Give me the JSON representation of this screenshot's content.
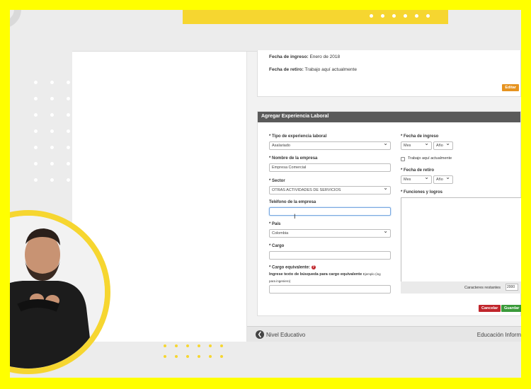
{
  "info": {
    "fecha_ingreso_label": "Fecha de ingreso:",
    "fecha_ingreso_value": "Enero de 2018",
    "fecha_retiro_label": "Fecha de retiro:",
    "fecha_retiro_value": "Trabajo aquí actualmente",
    "editar_label": "Editar"
  },
  "form": {
    "title": "Agregar Experiencia Laboral",
    "tipo_label": "* Tipo de experiencia laboral",
    "tipo_value": "Asalariado",
    "empresa_label": "* Nombre de la empresa",
    "empresa_value": "Empresa Comercial",
    "sector_label": "* Sector",
    "sector_value": "OTRAS ACTIVIDADES DE SERVICIOS",
    "telefono_label": "Teléfono de la empresa",
    "telefono_value": "",
    "pais_label": "* País",
    "pais_value": "Colombia",
    "cargo_label": "* Cargo",
    "cargo_value": "",
    "cargo_eq_label": "* Cargo equivalente:",
    "cargo_eq_help": "?",
    "cargo_eq_hint": "Ingrese texto de búsqueda para cargo equivalente",
    "cargo_eq_example": "Ejemplo (ing",
    "cargo_eq_example2": "para ingeniero)",
    "cargo_eq_value": "",
    "fecha_ingreso_label": "* Fecha de ingreso",
    "mes_value": "Mes",
    "anio_value": "Año",
    "actual_label": "Trabajo aquí actualmente",
    "fecha_retiro_label": "* Fecha de retiro",
    "mes2_value": "Mes",
    "anio2_value": "Año",
    "funciones_label": "* Funciones y logros",
    "caracteres_label": "Caracteres restantes",
    "caracteres_value": "2000",
    "cancelar_label": "Cancelar",
    "guardar_label": "Guardar"
  },
  "nav": {
    "back_label": "Nivel Educativo",
    "next_label": "Educación Inform"
  }
}
